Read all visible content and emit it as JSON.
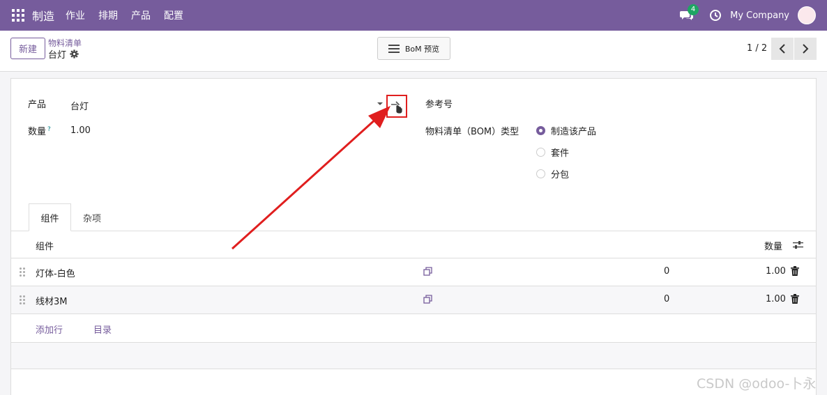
{
  "navbar": {
    "app_name": "制造",
    "menus": [
      "作业",
      "排期",
      "产品",
      "配置"
    ],
    "chat_badge": "4",
    "company": "My Company"
  },
  "control_panel": {
    "new_button": "新建",
    "breadcrumb_parent": "物料清单",
    "breadcrumb_current": "台灯",
    "bom_preview_button": "BoM 预览",
    "pager": "1 / 2"
  },
  "form": {
    "product_label": "产品",
    "product_value": "台灯",
    "quantity_label": "数量",
    "quantity_help": "?",
    "quantity_value": "1.00",
    "reference_label": "参考号",
    "bom_type_label": "物料清单（BOM）类型",
    "bom_type_options": [
      {
        "label": "制造该产品",
        "selected": true
      },
      {
        "label": "套件",
        "selected": false
      },
      {
        "label": "分包",
        "selected": false
      }
    ]
  },
  "tabs": [
    {
      "label": "组件",
      "active": true
    },
    {
      "label": "杂项",
      "active": false
    }
  ],
  "components_table": {
    "header_component": "组件",
    "header_quantity": "数量",
    "rows": [
      {
        "name": "灯体-白色",
        "col3": "0",
        "qty": "1.00"
      },
      {
        "name": "线材3M",
        "col3": "0",
        "qty": "1.00"
      }
    ],
    "add_line": "添加行",
    "catalog": "目录"
  },
  "colors": {
    "brand": "#765c9c",
    "annotation_red": "#e01e1e"
  },
  "watermark": "CSDN @odoo-卜永"
}
